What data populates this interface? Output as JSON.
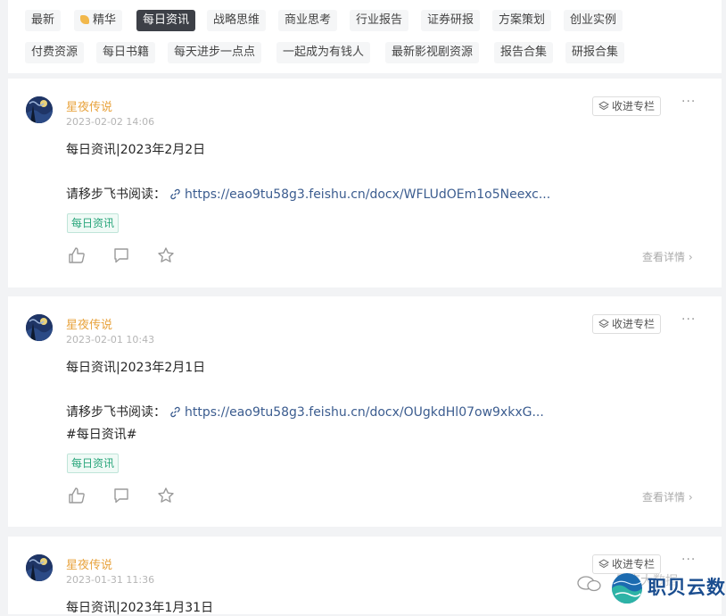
{
  "filters": {
    "row1": [
      {
        "label": "最新",
        "icon": null,
        "active": false
      },
      {
        "label": "精华",
        "icon": "diamond-icon",
        "active": false
      },
      {
        "label": "每日资讯",
        "icon": null,
        "active": true
      },
      {
        "label": "战略思维",
        "icon": null,
        "active": false
      },
      {
        "label": "商业思考",
        "icon": null,
        "active": false
      },
      {
        "label": "行业报告",
        "icon": null,
        "active": false
      },
      {
        "label": "证券研报",
        "icon": null,
        "active": false
      },
      {
        "label": "方案策划",
        "icon": null,
        "active": false
      },
      {
        "label": "创业实例",
        "icon": null,
        "active": false
      }
    ],
    "row2": [
      {
        "label": "付费资源"
      },
      {
        "label": "每日书籍"
      },
      {
        "label": "每天进步一点点"
      },
      {
        "label": "一起成为有钱人"
      },
      {
        "label": "最新影视剧资源"
      },
      {
        "label": "报告合集"
      },
      {
        "label": "研报合集"
      }
    ]
  },
  "posts": [
    {
      "author": "星夜传说",
      "time": "2023-02-02 14:06",
      "collect_label": "收进专栏",
      "more": "···",
      "title": "每日资讯|2023年2月2日",
      "read_prefix": "请移步飞书阅读：",
      "link": "https://eao9tu58g3.feishu.cn/docx/WFLUdOEm1o5Neexc...",
      "hashtag": "",
      "tag": "每日资讯",
      "detail": "查看详情"
    },
    {
      "author": "星夜传说",
      "time": "2023-02-01 10:43",
      "collect_label": "收进专栏",
      "more": "···",
      "title": "每日资讯|2023年2月1日",
      "read_prefix": "请移步飞书阅读：",
      "link": "https://eao9tu58g3.feishu.cn/docx/OUgkdHl07ow9xkxG...",
      "hashtag": "#每日资讯#",
      "tag": "每日资讯",
      "detail": "查看详情"
    },
    {
      "author": "星夜传说",
      "time": "2023-01-31 11:36",
      "collect_label": "收进专栏",
      "more": "···",
      "title": "每日资讯|2023年1月31日"
    }
  ],
  "watermark": {
    "text": "职贝云数",
    "ghost_text": "星座大数据"
  },
  "colors": {
    "author": "#e8a33d",
    "tag_green": "#27a57a",
    "link": "#3b5c8f",
    "active_chip": "#3d4047"
  }
}
